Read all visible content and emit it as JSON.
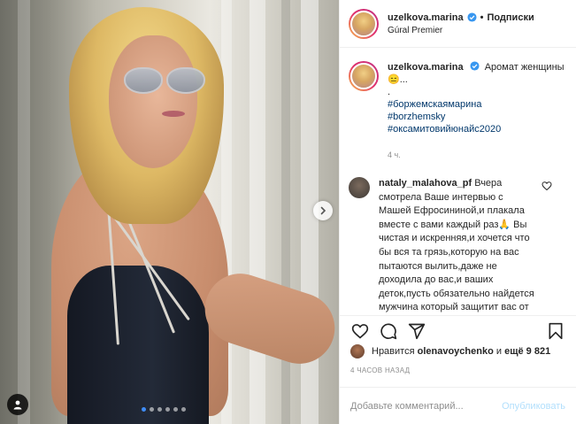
{
  "post": {
    "username": "uzelkova.marina",
    "separator": "•",
    "follow_label": "Подписки",
    "location": "Gúral Premier"
  },
  "caption": {
    "username": "uzelkova.marina",
    "text": "Аромат женщины😑...",
    "dot": ".",
    "hashtags": [
      "#боржемскаямарина",
      "#borzhemsky",
      "#оксамитовийюнайс2020"
    ],
    "timestamp": "4 ч."
  },
  "comment": {
    "username": "nataly_malahova_pf",
    "text": "Вчера смотрела Ваше интервью с Машей Ефросининой,и плакала вместе с вами каждый раз🙏 Вы чистая и искренняя,и хочется что бы вся та грязь,которую на вас пытаются вылить,даже не доходила до вас,и ваших деток,пусть обязательно найдется мужчина который защитит вас от всего и"
  },
  "likes": {
    "prefix": "Нравится",
    "user": "olenavoychenko",
    "middle": "и",
    "rest": "ещё 9 821"
  },
  "time_ago": "4 ЧАСОВ НАЗАД",
  "composer": {
    "placeholder": "Добавьте комментарий...",
    "post_label": "Опубликовать"
  },
  "carousel": {
    "slides": 6,
    "active_index": 0
  },
  "icons": {
    "verified": "verified-badge-icon",
    "like": "heart-icon",
    "comment": "comment-bubble-icon",
    "share": "paper-plane-icon",
    "save": "bookmark-icon",
    "next": "chevron-right-icon",
    "tag": "user-tag-icon"
  },
  "colors": {
    "accent": "#3897f0",
    "hashtag": "#00376b",
    "muted": "#8e8e8e",
    "post_disabled": "#b2dffc"
  }
}
